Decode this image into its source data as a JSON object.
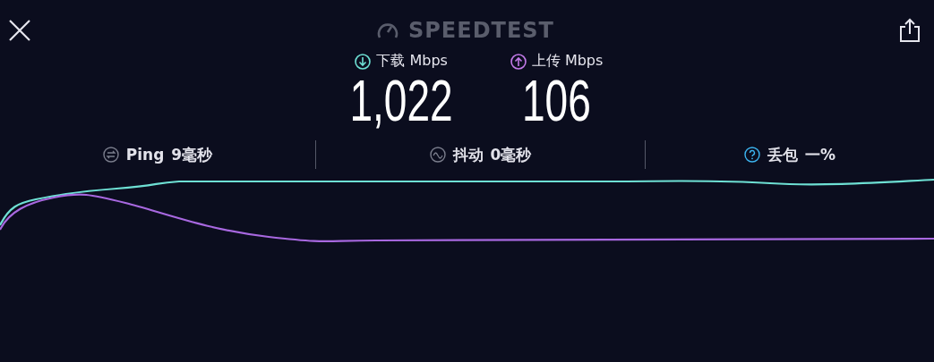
{
  "header": {
    "title": "SPEEDTEST"
  },
  "results": [
    {
      "kind": "download",
      "label": "下载 Mbps",
      "value": "1,022"
    },
    {
      "kind": "upload",
      "label": "上传 Mbps",
      "value": "106"
    }
  ],
  "stats": [
    {
      "kind": "ping",
      "label": "Ping",
      "value": "9毫秒"
    },
    {
      "kind": "jitter",
      "label": "抖动",
      "value": "0毫秒"
    },
    {
      "kind": "loss",
      "label": "丢包",
      "value": "一%"
    }
  ]
}
